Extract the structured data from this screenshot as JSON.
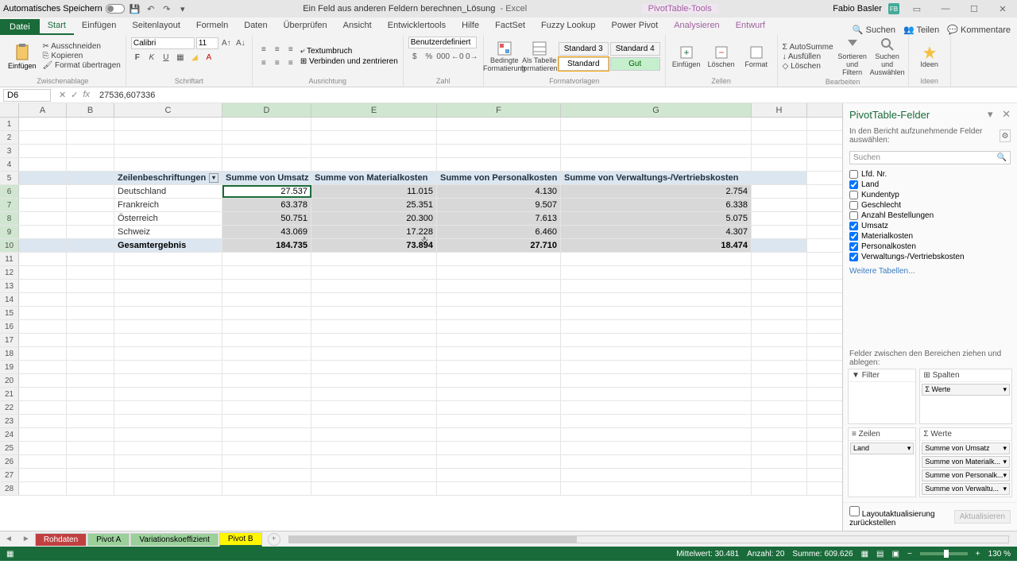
{
  "titlebar": {
    "autosave": "Automatisches Speichern",
    "filename": "Ein Feld aus anderen Feldern berechnen_Lösung",
    "app": "Excel",
    "context": "PivotTable-Tools",
    "user": "Fabio Basler",
    "avatar": "FB"
  },
  "ribbon": {
    "file": "Datei",
    "tabs": [
      "Start",
      "Einfügen",
      "Seitenlayout",
      "Formeln",
      "Daten",
      "Überprüfen",
      "Ansicht",
      "Entwicklertools",
      "Hilfe",
      "FactSet",
      "Fuzzy Lookup",
      "Power Pivot",
      "Analysieren",
      "Entwurf"
    ],
    "active_tab": 0,
    "search": "Suchen",
    "share": "Teilen",
    "comments": "Kommentare",
    "paste": "Einfügen",
    "cut": "Ausschneiden",
    "copy": "Kopieren",
    "format_painter": "Format übertragen",
    "clipboard_group": "Zwischenablage",
    "font_name": "Calibri",
    "font_size": "11",
    "font_group": "Schriftart",
    "wrap": "Textumbruch",
    "merge": "Verbinden und zentrieren",
    "align_group": "Ausrichtung",
    "number_format": "Benutzerdefiniert",
    "number_group": "Zahl",
    "cond_format": "Bedingte Formatierung",
    "as_table": "Als Tabelle formatieren",
    "style_std3": "Standard 3",
    "style_std4": "Standard 4",
    "style_std": "Standard",
    "style_gut": "Gut",
    "styles_group": "Formatvorlagen",
    "insert": "Einfügen",
    "delete": "Löschen",
    "format": "Format",
    "cells_group": "Zellen",
    "autosum": "AutoSumme",
    "fill": "Ausfüllen",
    "clear": "Löschen",
    "sort": "Sortieren und Filtern",
    "find": "Suchen und Auswählen",
    "ideas": "Ideen",
    "edit_group": "Bearbeiten",
    "ideas_group": "Ideen"
  },
  "formula": {
    "namebox": "D6",
    "value": "27536,607336"
  },
  "columns": [
    "A",
    "B",
    "C",
    "D",
    "E",
    "F",
    "G",
    "H"
  ],
  "pivot": {
    "row_header": "Zeilenbeschriftungen",
    "col_headers": [
      "Summe von Umsatz",
      "Summe von Materialkosten",
      "Summe von Personalkosten",
      "Summe von Verwaltungs-/Vertriebskosten"
    ],
    "rows": [
      {
        "label": "Deutschland",
        "vals": [
          "27.537",
          "11.015",
          "4.130",
          "2.754"
        ]
      },
      {
        "label": "Frankreich",
        "vals": [
          "63.378",
          "25.351",
          "9.507",
          "6.338"
        ]
      },
      {
        "label": "Österreich",
        "vals": [
          "50.751",
          "20.300",
          "7.613",
          "5.075"
        ]
      },
      {
        "label": "Schweiz",
        "vals": [
          "43.069",
          "17.228",
          "6.460",
          "4.307"
        ]
      }
    ],
    "total_label": "Gesamtergebnis",
    "totals": [
      "184.735",
      "73.894",
      "27.710",
      "18.474"
    ]
  },
  "panel": {
    "title": "PivotTable-Felder",
    "subtitle": "In den Bericht aufzunehmende Felder auswählen:",
    "search": "Suchen",
    "fields": [
      {
        "label": "Lfd. Nr.",
        "checked": false
      },
      {
        "label": "Land",
        "checked": true
      },
      {
        "label": "Kundentyp",
        "checked": false
      },
      {
        "label": "Geschlecht",
        "checked": false
      },
      {
        "label": "Anzahl Bestellungen",
        "checked": false
      },
      {
        "label": "Umsatz",
        "checked": true
      },
      {
        "label": "Materialkosten",
        "checked": true
      },
      {
        "label": "Personalkosten",
        "checked": true
      },
      {
        "label": "Verwaltungs-/Vertriebskosten",
        "checked": true
      }
    ],
    "more_tables": "Weitere Tabellen...",
    "drop_hint": "Felder zwischen den Bereichen ziehen und ablegen:",
    "filter": "Filter",
    "columns_area": "Spalten",
    "columns_item": "Σ Werte",
    "rows_area": "Zeilen",
    "rows_item": "Land",
    "values_area": "Werte",
    "values_items": [
      "Summe von Umsatz",
      "Summe von Materialk...",
      "Summe von Personalk...",
      "Summe von Verwaltu..."
    ],
    "defer": "Layoutaktualisierung zurückstellen",
    "update": "Aktualisieren"
  },
  "sheets": {
    "tabs": [
      "Rohdaten",
      "Pivot A",
      "Variationskoeffizient",
      "Pivot B"
    ],
    "active": 3
  },
  "status": {
    "avg_label": "Mittelwert:",
    "avg": "30.481",
    "count_label": "Anzahl:",
    "count": "20",
    "sum_label": "Summe:",
    "sum": "609.626",
    "zoom": "130 %"
  }
}
